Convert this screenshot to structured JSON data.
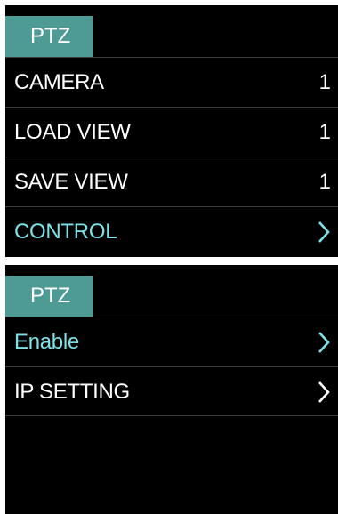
{
  "colors": {
    "background": "#000000",
    "tab": "#4e9a95",
    "text": "#ffffff",
    "highlight": "#7ce2e6",
    "divider": "#3c3c3c"
  },
  "top_menu": {
    "tab_label": "PTZ",
    "items": [
      {
        "label": "CAMERA",
        "value": "1"
      },
      {
        "label": "LOAD VIEW",
        "value": "1"
      },
      {
        "label": "SAVE VIEW",
        "value": "1"
      },
      {
        "label": "CONTROL",
        "icon": "chevron-right-icon",
        "selected": true
      }
    ]
  },
  "bottom_menu": {
    "tab_label": "PTZ",
    "items": [
      {
        "label": "Enable",
        "icon": "chevron-right-icon",
        "selected": true
      },
      {
        "label": "IP SETTING",
        "icon": "chevron-right-icon"
      }
    ]
  }
}
